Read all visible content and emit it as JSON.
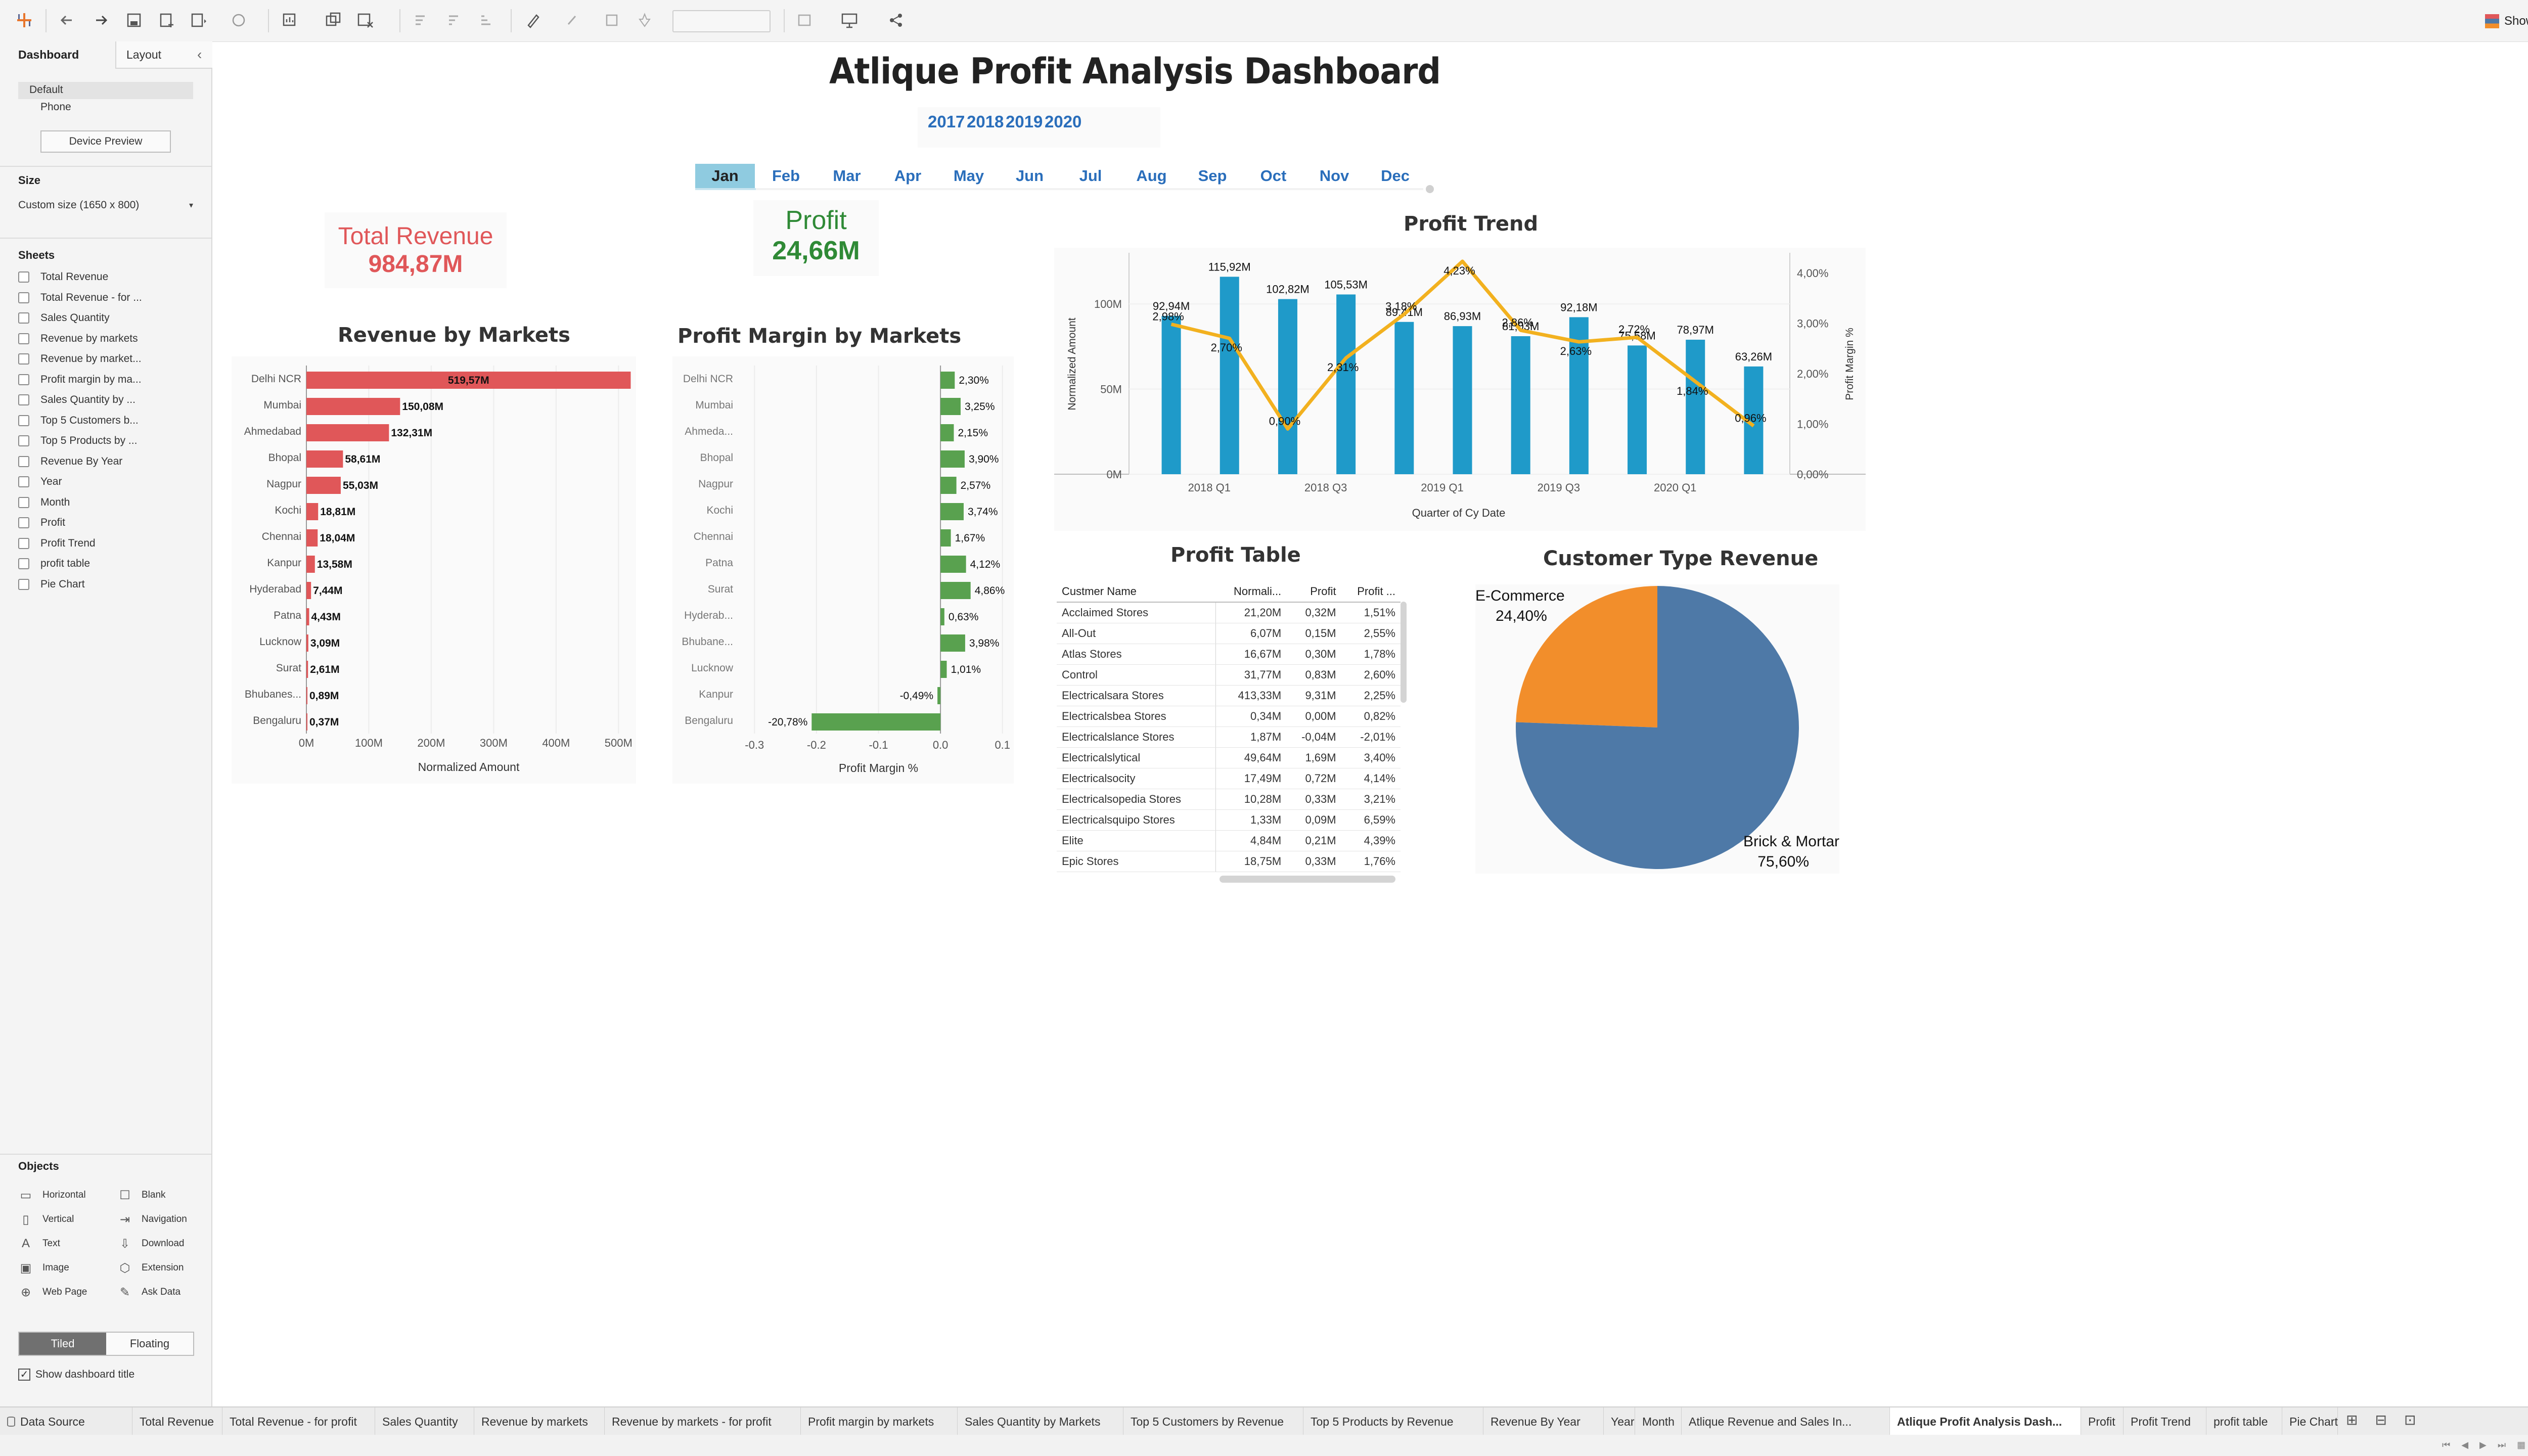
{
  "toolbar": {
    "icons": [
      "tableau-logo-icon",
      "undo-icon",
      "redo-icon",
      "save-icon",
      "new-datasource-icon",
      "pause-updates-icon",
      "refresh-icon",
      "new-worksheet-icon",
      "duplicate-icon",
      "clear-icon",
      "swap-icon",
      "sort-ascending-icon",
      "sort-descending-icon",
      "highlight-icon",
      "group-icon",
      "label-icon",
      "pin-icon",
      "fit-dropdown",
      "show-cards-icon",
      "presentation-icon",
      "share-icon"
    ],
    "show_me_label": "Show Me"
  },
  "left_pane": {
    "tab_dashboard": "Dashboard",
    "tab_layout": "Layout",
    "devices": [
      "Default",
      "Phone"
    ],
    "device_preview_label": "Device Preview",
    "size_heading": "Size",
    "size_value": "Custom size (1650 x 800)",
    "sheets_heading": "Sheets",
    "sheets": [
      "Total Revenue",
      "Total Revenue - for ...",
      "Sales Quantity",
      "Revenue by markets",
      "Revenue by market...",
      "Profit margin by ma...",
      "Sales Quantity by ...",
      "Top 5 Customers b...",
      "Top 5 Products by ...",
      "Revenue By Year",
      "Year",
      "Month",
      "Profit",
      "Profit Trend",
      "profit table",
      "Pie Chart"
    ],
    "objects_heading": "Objects",
    "objects": [
      {
        "label": "Horizontal",
        "icon": "horizontal-container-icon"
      },
      {
        "label": "Blank",
        "icon": "blank-icon"
      },
      {
        "label": "Vertical",
        "icon": "vertical-container-icon"
      },
      {
        "label": "Navigation",
        "icon": "navigation-icon"
      },
      {
        "label": "Text",
        "icon": "text-icon"
      },
      {
        "label": "Download",
        "icon": "download-icon"
      },
      {
        "label": "Image",
        "icon": "image-icon"
      },
      {
        "label": "Extension",
        "icon": "extension-icon"
      },
      {
        "label": "Web Page",
        "icon": "web-page-icon"
      },
      {
        "label": "Ask Data",
        "icon": "ask-data-icon"
      }
    ],
    "tiled_label": "Tiled",
    "floating_label": "Floating",
    "show_title_label": "Show dashboard title",
    "show_title_checked": true
  },
  "dashboard": {
    "title": "Atlique Profit Analysis Dashboard",
    "years": [
      "2017",
      "2018",
      "2019",
      "2020"
    ],
    "months": [
      "Jan",
      "Feb",
      "Mar",
      "Apr",
      "May",
      "Jun",
      "Jul",
      "Aug",
      "Sep",
      "Oct",
      "Nov",
      "Dec"
    ],
    "selected_month": "Jan",
    "total_revenue_label": "Total Revenue",
    "total_revenue_value": "984,87M",
    "profit_label": "Profit",
    "profit_value": "24,66M",
    "revenue_color": "#e05759",
    "profit_color": "#2f8a36"
  },
  "chart_data": [
    {
      "type": "bar",
      "title": "Revenue by Markets",
      "xlabel": "Normalized Amount",
      "categories": [
        "Delhi NCR",
        "Mumbai",
        "Ahmedabad",
        "Bhopal",
        "Nagpur",
        "Kochi",
        "Chennai",
        "Kanpur",
        "Hyderabad",
        "Patna",
        "Lucknow",
        "Surat",
        "Bhubanes...",
        "Bengaluru"
      ],
      "values": [
        519.57,
        150.08,
        132.31,
        58.61,
        55.03,
        18.81,
        18.04,
        13.58,
        7.44,
        4.43,
        3.09,
        2.61,
        0.89,
        0.37
      ],
      "labels": [
        "519,57M",
        "150,08M",
        "132,31M",
        "58,61M",
        "55,03M",
        "18,81M",
        "18,04M",
        "13,58M",
        "7,44M",
        "4,43M",
        "3,09M",
        "2,61M",
        "0,89M",
        "0,37M"
      ],
      "xticks": [
        "0M",
        "100M",
        "200M",
        "300M",
        "400M",
        "500M"
      ],
      "xlim": [
        0,
        520
      ],
      "color": "#e05759"
    },
    {
      "type": "bar",
      "title": "Profit Margin by Markets",
      "xlabel": "Profit Margin %",
      "categories": [
        "Delhi NCR",
        "Mumbai",
        "Ahmeda...",
        "Bhopal",
        "Nagpur",
        "Kochi",
        "Chennai",
        "Patna",
        "Surat",
        "Hyderab...",
        "Bhubane...",
        "Lucknow",
        "Kanpur",
        "Bengaluru"
      ],
      "values": [
        2.3,
        3.25,
        2.15,
        3.9,
        2.57,
        3.74,
        1.67,
        4.12,
        4.86,
        0.63,
        3.98,
        1.01,
        -0.49,
        -20.78
      ],
      "labels": [
        "2,30%",
        "3,25%",
        "2,15%",
        "3,90%",
        "2,57%",
        "3,74%",
        "1,67%",
        "4,12%",
        "4,86%",
        "0,63%",
        "3,98%",
        "1,01%",
        "-0,49%",
        "-20,78%"
      ],
      "xticks": [
        "-0.3",
        "-0.2",
        "-0.1",
        "0.0",
        "0.1"
      ],
      "xlim": [
        -0.31,
        0.11
      ],
      "color": "#59a14f"
    },
    {
      "type": "bar+line",
      "title": "Profit Trend",
      "xlabel": "Quarter of Cy Date",
      "ylabel": "Normalized Amount",
      "y2label": "Profit Margin %",
      "bar_values": [
        92.94,
        115.92,
        102.82,
        105.53,
        89.41,
        86.93,
        81.03,
        92.18,
        75.58,
        78.97,
        63.26
      ],
      "bar_labels": [
        "92,94M",
        "115,92M",
        "102,82M",
        "105,53M",
        "89,41M",
        "86,93M",
        "81,03M",
        "92,18M",
        "75,58M",
        "78,97M",
        "63,26M"
      ],
      "line_values": [
        2.98,
        2.7,
        0.9,
        2.31,
        3.18,
        4.23,
        2.86,
        2.63,
        2.72,
        1.84,
        0.96
      ],
      "line_labels": [
        "2,98%",
        "2,70%",
        "0,90%",
        "2,31%",
        "3,18%",
        "4,23%",
        "2,86%",
        "2,63%",
        "2,72%",
        "1,84%",
        "0,96%"
      ],
      "xticks": [
        "2018 Q1",
        "2018 Q3",
        "2019 Q1",
        "2019 Q3",
        "2020 Q1"
      ],
      "yticks": [
        "0M",
        "50M",
        "100M"
      ],
      "ylim": [
        0,
        130
      ],
      "y2ticks": [
        "0,00%",
        "1,00%",
        "2,00%",
        "3,00%",
        "4,00%"
      ],
      "y2lim": [
        0,
        4.4
      ],
      "bar_color": "#1f9ac9",
      "line_color": "#f2b11f"
    },
    {
      "type": "table",
      "title": "Profit Table",
      "columns": [
        "Custmer Name",
        "Normali...",
        "Profit",
        "Profit ..."
      ],
      "rows": [
        [
          "Acclaimed Stores",
          "21,20M",
          "0,32M",
          "1,51%"
        ],
        [
          "All-Out",
          "6,07M",
          "0,15M",
          "2,55%"
        ],
        [
          "Atlas Stores",
          "16,67M",
          "0,30M",
          "1,78%"
        ],
        [
          "Control",
          "31,77M",
          "0,83M",
          "2,60%"
        ],
        [
          "Electricalsara Stores",
          "413,33M",
          "9,31M",
          "2,25%"
        ],
        [
          "Electricalsbea Stores",
          "0,34M",
          "0,00M",
          "0,82%"
        ],
        [
          "Electricalslance Stores",
          "1,87M",
          "-0,04M",
          "-2,01%"
        ],
        [
          "Electricalslytical",
          "49,64M",
          "1,69M",
          "3,40%"
        ],
        [
          "Electricalsocity",
          "17,49M",
          "0,72M",
          "4,14%"
        ],
        [
          "Electricalsopedia Stores",
          "10,28M",
          "0,33M",
          "3,21%"
        ],
        [
          "Electricalsquipo Stores",
          "1,33M",
          "0,09M",
          "6,59%"
        ],
        [
          "Elite",
          "4,84M",
          "0,21M",
          "4,39%"
        ],
        [
          "Epic Stores",
          "18,75M",
          "0,33M",
          "1,76%"
        ]
      ]
    },
    {
      "type": "pie",
      "title": "Customer Type Revenue",
      "categories": [
        "E-Commerce",
        "Brick & Mortar"
      ],
      "values": [
        24.4,
        75.6
      ],
      "labels": [
        "24,40%",
        "75,60%"
      ],
      "colors": [
        "#f28e2b",
        "#4e79a7"
      ]
    }
  ],
  "bottom_tabs": {
    "data_source": "Data Source",
    "tabs": [
      "Total Revenue",
      "Total Revenue - for profit",
      "Sales Quantity",
      "Revenue by markets",
      "Revenue by markets - for profit",
      "Profit margin by markets",
      "Sales Quantity by Markets",
      "Top 5 Customers by Revenue",
      "Top 5 Products by Revenue",
      "Revenue By Year",
      "Year",
      "Month",
      "Atlique Revenue and  Sales In...",
      "Atlique Profit Analysis Dash...",
      "Profit",
      "Profit Trend",
      "profit table",
      "Pie Chart"
    ],
    "active_tab": "Atlique Profit Analysis Dash..."
  }
}
